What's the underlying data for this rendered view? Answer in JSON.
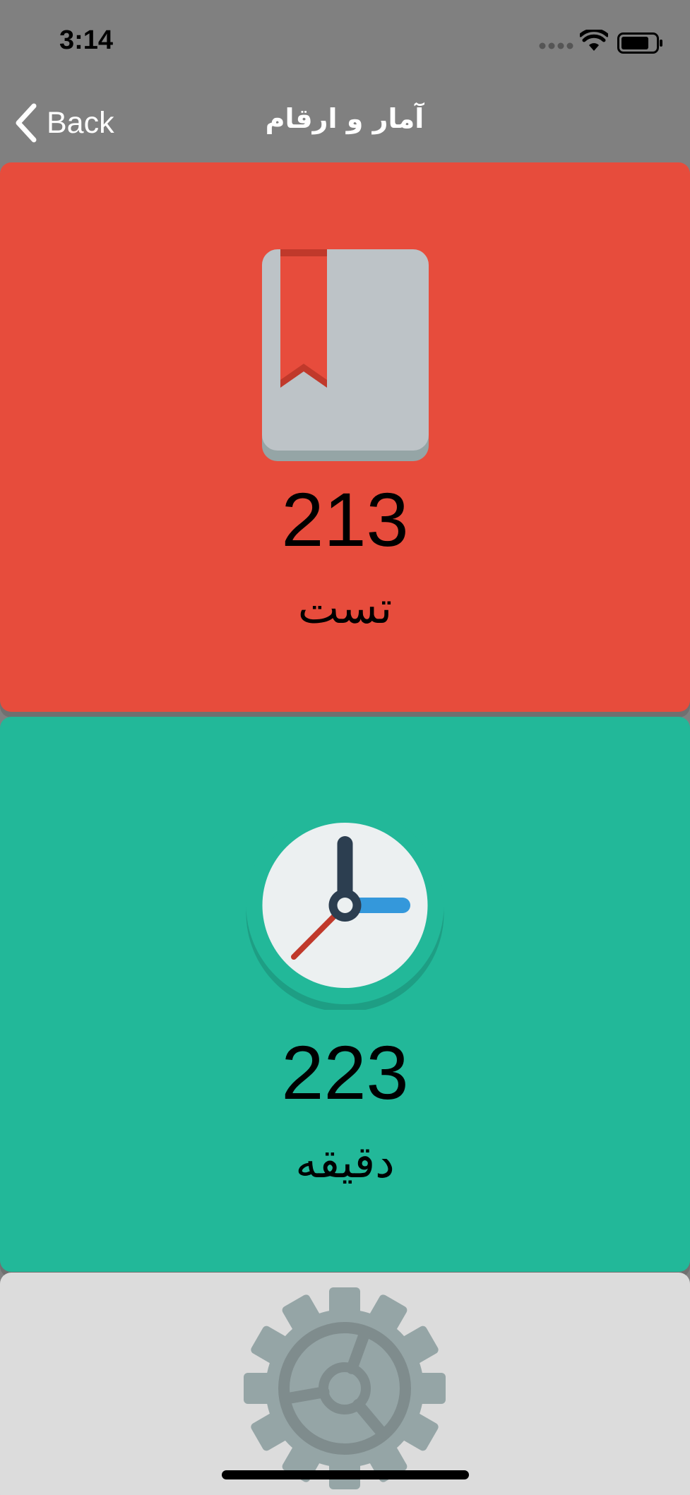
{
  "status_bar": {
    "time": "3:14",
    "icons": [
      "signal-dots-icon",
      "wifi-icon",
      "battery-icon"
    ]
  },
  "nav": {
    "back_label": "Back",
    "title": "آمار و ارقام",
    "back_icon": "chevron-left-icon"
  },
  "cards": {
    "tests": {
      "icon": "bookmarked-book-icon",
      "value": "213",
      "label": "تست",
      "color": "#e74c3c"
    },
    "minutes": {
      "icon": "clock-icon",
      "value": "223",
      "label": "دقیقه",
      "color": "#22b899"
    },
    "settings": {
      "icon": "gear-icon",
      "color": "#dcdcdc"
    }
  }
}
